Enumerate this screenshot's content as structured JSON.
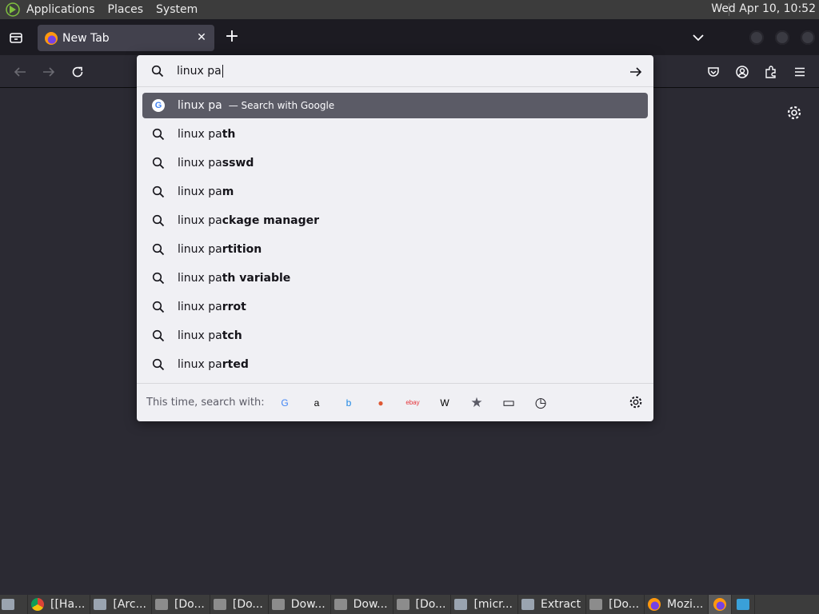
{
  "top_panel": {
    "menus": [
      "Applications",
      "Places",
      "System"
    ],
    "clock": "Wed Apr 10, 10:52"
  },
  "tabs": [
    {
      "label": "New Tab",
      "close_glyph": "✕"
    }
  ],
  "url_input": {
    "value": "linux pa"
  },
  "first_result": {
    "query": "linux pa",
    "action": "— Search with Google"
  },
  "suggestions": [
    {
      "typed": "linux pa",
      "rest": "th"
    },
    {
      "typed": "linux pa",
      "rest": "sswd"
    },
    {
      "typed": "linux pa",
      "rest": "m"
    },
    {
      "typed": "linux pa",
      "rest": "ckage manager"
    },
    {
      "typed": "linux pa",
      "rest": "rtition"
    },
    {
      "typed": "linux pa",
      "rest": "th variable"
    },
    {
      "typed": "linux pa",
      "rest": "rrot"
    },
    {
      "typed": "linux pa",
      "rest": "tch"
    },
    {
      "typed": "linux pa",
      "rest": "rted"
    }
  ],
  "one_off": {
    "label": "This time, search with:",
    "engines": [
      {
        "name": "google-icon",
        "glyph": "G",
        "color": "#4285f4"
      },
      {
        "name": "amazon-icon",
        "glyph": "a",
        "color": "#000000"
      },
      {
        "name": "bing-icon",
        "glyph": "b",
        "color": "#1e88e5"
      },
      {
        "name": "duckduckgo-icon",
        "glyph": "●",
        "color": "#de5833"
      },
      {
        "name": "ebay-icon",
        "glyph": "ebay",
        "color": "#e53238"
      },
      {
        "name": "wikipedia-icon",
        "glyph": "W",
        "color": "#000000"
      },
      {
        "name": "bookmarks-icon",
        "glyph": "★",
        "color": "#5b5b66"
      },
      {
        "name": "tabs-icon",
        "glyph": "▭",
        "color": "#15141a"
      },
      {
        "name": "history-icon",
        "glyph": "◷",
        "color": "#15141a"
      }
    ]
  },
  "taskbar": {
    "items": [
      {
        "label": "[[Ha...",
        "icon": "chrome"
      },
      {
        "label": "[Arc...",
        "icon": "win"
      },
      {
        "label": "[Do...",
        "icon": "folder"
      },
      {
        "label": "[Do...",
        "icon": "folder"
      },
      {
        "label": "Dow...",
        "icon": "folder"
      },
      {
        "label": "Dow...",
        "icon": "folder"
      },
      {
        "label": "[Do...",
        "icon": "folder"
      },
      {
        "label": "[micr...",
        "icon": "win"
      },
      {
        "label": "Extract",
        "icon": "win"
      },
      {
        "label": "[Do...",
        "icon": "folder"
      },
      {
        "label": "Mozi...",
        "icon": "fx"
      }
    ]
  },
  "colors": {
    "content_bg": "#2b2a33",
    "tabstrip_bg": "#1c1b22",
    "dropdown_bg": "#f0f0f4",
    "selected_row": "#5b5b66",
    "panel_bg": "#3c3c3c"
  }
}
